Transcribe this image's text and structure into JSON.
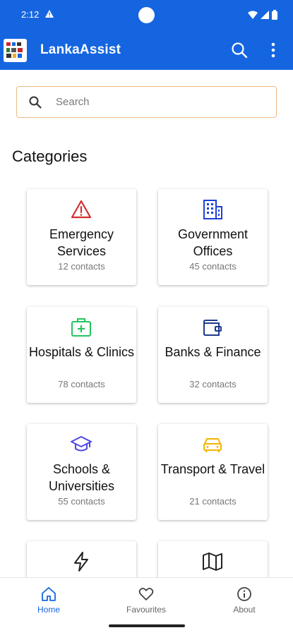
{
  "status_bar": {
    "time": "2:12"
  },
  "app_bar": {
    "title": "LankaAssist"
  },
  "search": {
    "placeholder": "Search"
  },
  "section": {
    "title": "Categories"
  },
  "categories": [
    {
      "title": "Emergency Services",
      "count": "12 contacts",
      "icon": "warning-icon",
      "color": "#d32f2f"
    },
    {
      "title": "Government Offices",
      "count": "45 contacts",
      "icon": "building-icon",
      "color": "#1e40d8"
    },
    {
      "title": "Hospitals & Clinics",
      "count": "78 contacts",
      "icon": "medical-kit-icon",
      "color": "#22c55e"
    },
    {
      "title": "Banks & Finance",
      "count": "32 contacts",
      "icon": "wallet-icon",
      "color": "#1e3a8a"
    },
    {
      "title": "Schools & Universities",
      "count": "55 contacts",
      "icon": "graduation-cap-icon",
      "color": "#4f46e5"
    },
    {
      "title": "Transport & Travel",
      "count": "21 contacts",
      "icon": "car-icon",
      "color": "#f5b301"
    },
    {
      "title": "",
      "count": "",
      "icon": "lightning-icon",
      "color": "#222222"
    },
    {
      "title": "",
      "count": "",
      "icon": "map-icon",
      "color": "#222222"
    }
  ],
  "bottom_nav": {
    "items": [
      {
        "label": "Home",
        "icon": "home-icon",
        "active": true
      },
      {
        "label": "Favourites",
        "icon": "heart-icon",
        "active": false
      },
      {
        "label": "About",
        "icon": "info-icon",
        "active": false
      }
    ]
  },
  "colors": {
    "primary": "#1565e0",
    "search_border": "#f0b887"
  }
}
